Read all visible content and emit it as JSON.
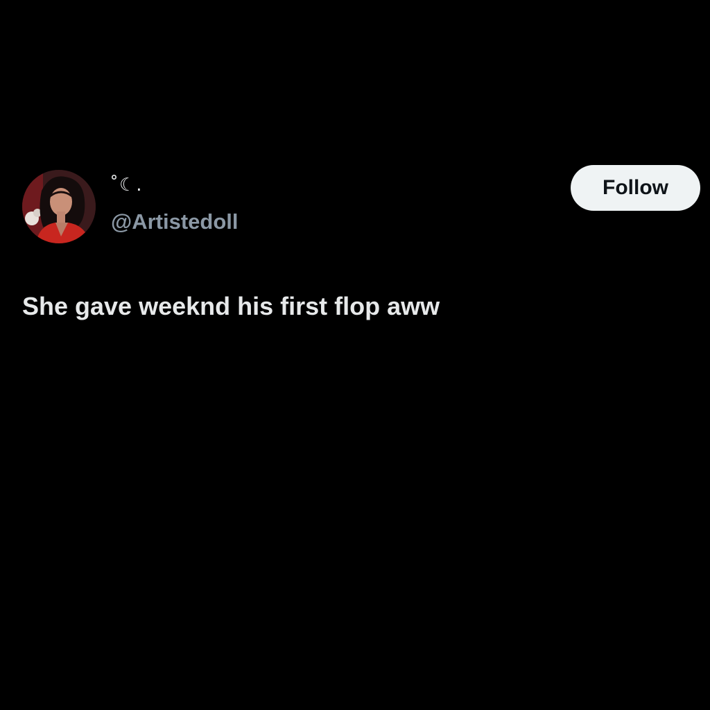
{
  "tweet": {
    "author": {
      "display_name": "˚☾.",
      "handle": "@Artistedoll",
      "avatar": "profile-photo-woman-red-dress"
    },
    "follow_label": "Follow",
    "text": "She gave weeknd his first flop aww"
  },
  "colors": {
    "background": "#000000",
    "primary_text": "#e7e9ea",
    "secondary_text": "#8b98a5",
    "button_bg": "#eff3f4",
    "button_text": "#0f1419"
  }
}
